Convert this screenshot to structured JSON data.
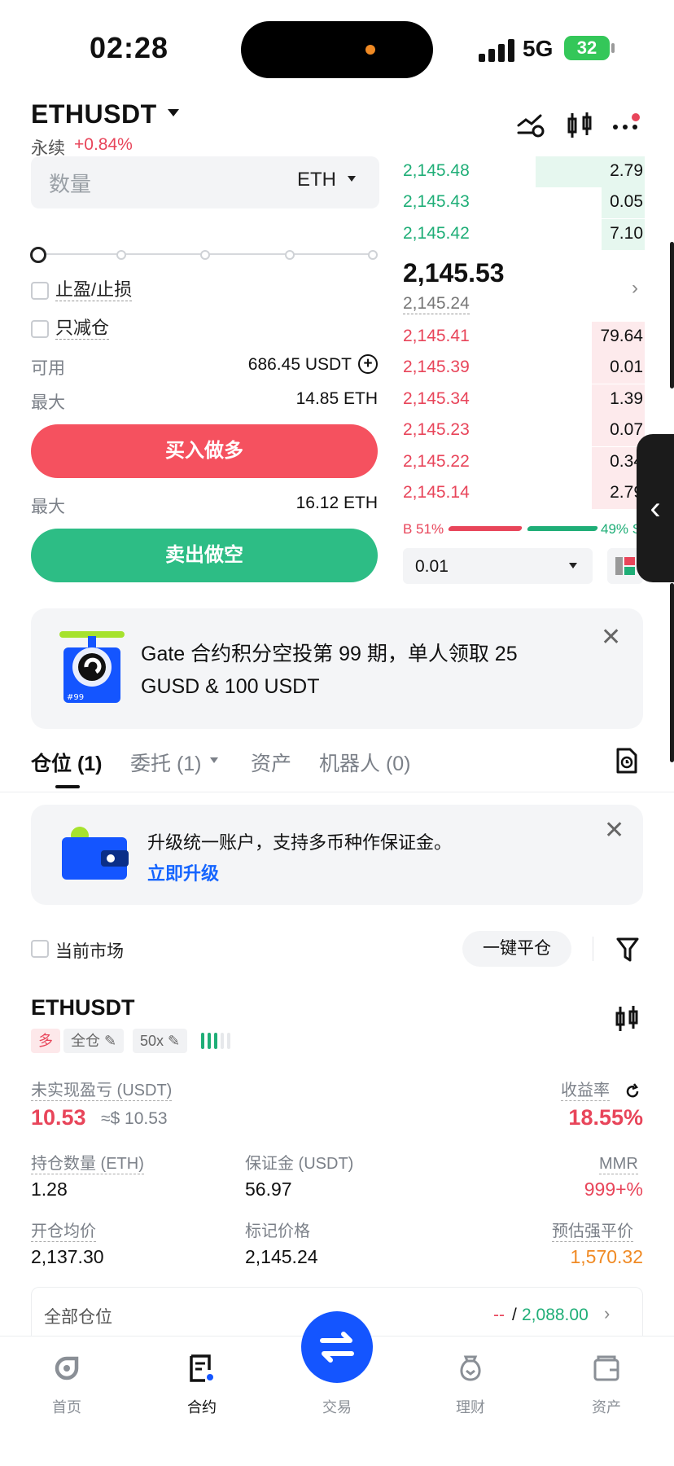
{
  "status_bar": {
    "time": "02:28",
    "network": "5G",
    "battery": "32"
  },
  "header": {
    "pair": "ETHUSDT",
    "contract_type": "永续",
    "change": "+0.84%"
  },
  "order_form": {
    "quantity_placeholder": "数量",
    "quantity_unit": "ETH",
    "tp_sl_label": "止盈/止损",
    "reduce_only_label": "只减仓",
    "available_label": "可用",
    "available_value": "686.45 USDT",
    "max_buy_label": "最大",
    "max_buy_value": "14.85 ETH",
    "buy_button": "买入做多",
    "max_sell_label": "最大",
    "max_sell_value": "16.12 ETH",
    "sell_button": "卖出做空"
  },
  "order_book": {
    "asks": [
      {
        "price": "2,145.48",
        "qty": "2.79",
        "depth": 0.45
      },
      {
        "price": "2,145.43",
        "qty": "0.05",
        "depth": 0.18
      },
      {
        "price": "2,145.42",
        "qty": "7.10",
        "depth": 0.18
      }
    ],
    "last_price": "2,145.53",
    "mark_price": "2,145.24",
    "bids": [
      {
        "price": "2,145.41",
        "qty": "79.64",
        "depth": 0.22
      },
      {
        "price": "2,145.39",
        "qty": "0.01",
        "depth": 0.22
      },
      {
        "price": "2,145.34",
        "qty": "1.39",
        "depth": 0.22
      },
      {
        "price": "2,145.23",
        "qty": "0.07",
        "depth": 0.22
      },
      {
        "price": "2,145.22",
        "qty": "0.34",
        "depth": 0.22
      },
      {
        "price": "2,145.14",
        "qty": "2.79",
        "depth": 0.22
      }
    ],
    "buy_ratio": "B 51%",
    "sell_ratio": "49% S",
    "precision": "0.01"
  },
  "promo": {
    "text": "Gate 合约积分空投第 99 期，单人领取 25 GUSD & 100 USDT",
    "badge": "#99"
  },
  "tabs": [
    {
      "label": "仓位 (1)"
    },
    {
      "label": "委托 (1)"
    },
    {
      "label": "资产"
    },
    {
      "label": "机器人 (0)"
    }
  ],
  "upgrade": {
    "text": "升级统一账户，支持多币种作保证金。",
    "link": "立即升级"
  },
  "filter": {
    "current_market": "当前市场",
    "close_all": "一键平仓"
  },
  "position": {
    "symbol": "ETHUSDT",
    "side": "多",
    "margin_mode": "全仓",
    "leverage": "50x",
    "unrealized_pnl_label": "未实现盈亏 (USDT)",
    "unrealized_pnl": "10.53",
    "unrealized_pnl_usd": "≈$ 10.53",
    "roe_label": "收益率",
    "roe": "18.55%",
    "size_label": "持仓数量 (ETH)",
    "size": "1.28",
    "margin_label": "保证金 (USDT)",
    "margin": "56.97",
    "mmr_label": "MMR",
    "mmr": "999+%",
    "entry_label": "开仓均价",
    "entry": "2,137.30",
    "mark_label": "标记价格",
    "mark": "2,145.24",
    "liq_label": "预估强平价",
    "liq": "1,570.32"
  },
  "all_positions": {
    "label": "全部仓位",
    "left": "--",
    "separator": "/",
    "right": "2,088.00"
  },
  "bottom_nav": [
    {
      "label": "首页"
    },
    {
      "label": "合约"
    },
    {
      "label": "交易"
    },
    {
      "label": "理财"
    },
    {
      "label": "资产"
    }
  ],
  "colors": {
    "buy": "#f5515f",
    "sell": "#2dbd85",
    "accent": "#1455ff",
    "liq": "#f08a24"
  }
}
